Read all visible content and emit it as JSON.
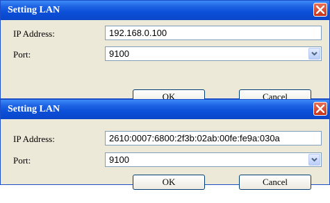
{
  "dialogs": [
    {
      "title": "Setting LAN",
      "ip_label": "IP Address:",
      "ip_value": "192.168.0.100",
      "port_label": "Port:",
      "port_value": "9100",
      "ok_label": "OK",
      "cancel_label": "Cancel"
    },
    {
      "title": "Setting LAN",
      "ip_label": "IP Address:",
      "ip_value": "2610:0007:6800:2f3b:02ab:00fe:fe9a:030a",
      "port_label": "Port:",
      "port_value": "9100",
      "ok_label": "OK",
      "cancel_label": "Cancel"
    }
  ],
  "icons": {
    "close": "close-icon",
    "dropdown": "chevron-down-icon"
  },
  "colors": {
    "titlebar": "#0b4fd8",
    "close_button": "#d3502f",
    "dialog_background": "#ece9d8",
    "field_border": "#7f9db9"
  }
}
